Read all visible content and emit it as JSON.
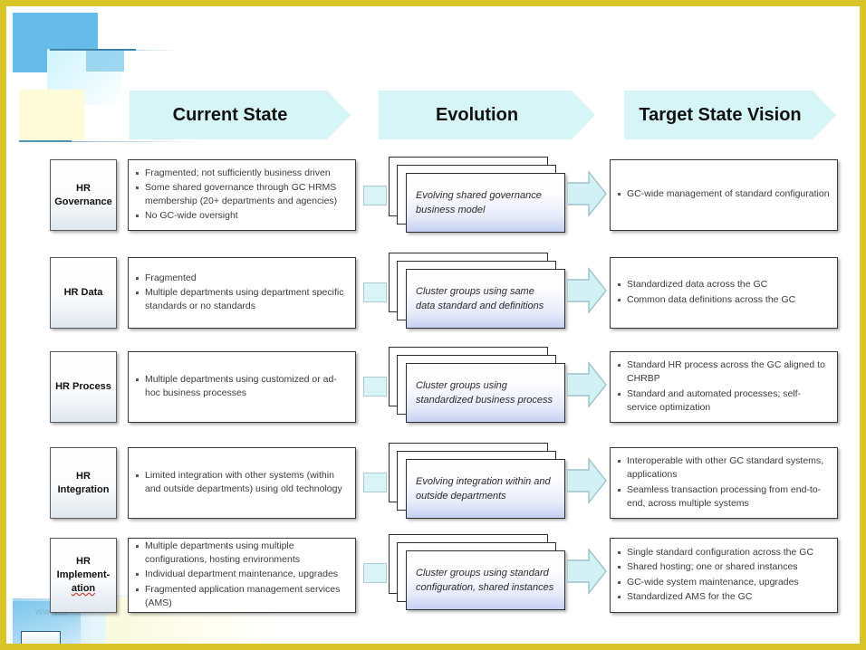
{
  "slide": {
    "border_color": "#d9c528",
    "accent_blue": "#66bbe8",
    "banner_fill": "#d6f5f6",
    "watermark": "www.h"
  },
  "headers": [
    {
      "label": "Current State"
    },
    {
      "label": "Evolution"
    },
    {
      "label": "Target State Vision"
    }
  ],
  "rows": [
    {
      "label": "HR Governance",
      "label_lines": [
        "HR",
        "Governance"
      ],
      "current": [
        "Fragmented; not sufficiently  business driven",
        "Some shared governance through GC HRMS membership (20+ departments and agencies)",
        "No GC-wide oversight"
      ],
      "evolution": "Evolving shared governance business model",
      "target": [
        "GC-wide management of standard configuration"
      ]
    },
    {
      "label": "HR Data",
      "label_lines": [
        "HR Data"
      ],
      "current": [
        "Fragmented",
        "Multiple  departments using department specific standards or no standards"
      ],
      "evolution": "Cluster groups using same data standard and definitions",
      "target": [
        "Standardized data across the GC",
        "Common data definitions  across the GC"
      ]
    },
    {
      "label": "HR Process",
      "label_lines": [
        "HR Process"
      ],
      "current": [
        "Multiple  departments using customized  or ad-hoc business processes"
      ],
      "evolution": "Cluster groups using standardized business process",
      "target": [
        "Standard HR process across the GC aligned to CHRBP",
        "Standard and automated processes;  self-service optimization"
      ]
    },
    {
      "label": "HR Integration",
      "label_lines": [
        "HR",
        "Integration"
      ],
      "current": [
        "Limited integration with other systems  (within and outside departments) using old technology"
      ],
      "evolution": "Evolving  integration within and outside departments",
      "target": [
        "Interoperable  with other GC standard  systems, applications",
        "Seamless transaction processing  from end-to-end, across multiple systems"
      ]
    },
    {
      "label": "HR Implementation",
      "label_lines": [
        "HR",
        "Implement-",
        "ation"
      ],
      "current": [
        "Multiple  departments using multiple configurations,  hosting environments",
        "Individual department maintenance, upgrades",
        "Fragmented application  management services (AMS)"
      ],
      "evolution": "Cluster groups using standard configuration, shared instances",
      "target": [
        "Single standard configuration  across the GC",
        "Shared hosting; one or shared instances",
        "GC-wide system  maintenance, upgrades",
        "Standardized  AMS for the GC"
      ]
    }
  ]
}
